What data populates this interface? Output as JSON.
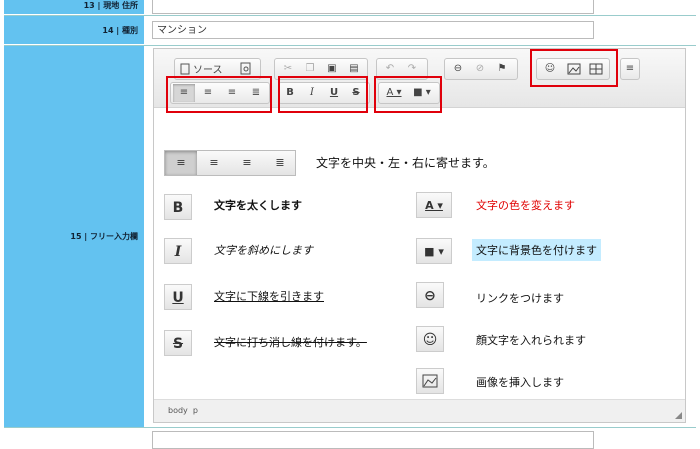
{
  "form": {
    "row13": {
      "label": "13 | 現地 住所",
      "value": ""
    },
    "row14": {
      "label": "14 | 種別",
      "value": "マンション"
    },
    "row15": {
      "label": "15 | フリー入力欄"
    }
  },
  "toolbar": {
    "source_label": "ソース",
    "icons": [
      "document-icon",
      "preview-icon",
      "cut-icon",
      "copy-icon",
      "paste-icon",
      "paste-text-icon",
      "undo-icon",
      "redo-icon",
      "link-icon",
      "unlink-icon",
      "flag-icon",
      "smiley-icon",
      "image-icon",
      "table-icon",
      "hr-icon",
      "align-left-icon",
      "align-center-icon",
      "align-right-icon",
      "align-justify-icon",
      "bold-icon",
      "italic-icon",
      "underline-icon",
      "strike-icon",
      "text-color-icon",
      "bg-color-icon"
    ]
  },
  "content": {
    "align_text": "文字を中央・左・右に寄せます。",
    "bold_text": "文字を太くします",
    "italic_text": "文字を斜めにします",
    "underline_text": "文字に下線を引きます",
    "strike_text": "文字に打ち消し線を付けます。",
    "color_text": "文字の色を変えます",
    "bgcolor_text": "文字に背景色を付けます",
    "link_text": "リンクをつけます",
    "smiley_text": "顔文字を入れられます",
    "image_text": "画像を挿入します"
  },
  "status": {
    "path": "body  p"
  },
  "colors": {
    "label_bg": "#63c2f0",
    "highlight_red": "#e0000b",
    "red_text": "#e00000",
    "bg_highlight": "#c4ecff"
  }
}
